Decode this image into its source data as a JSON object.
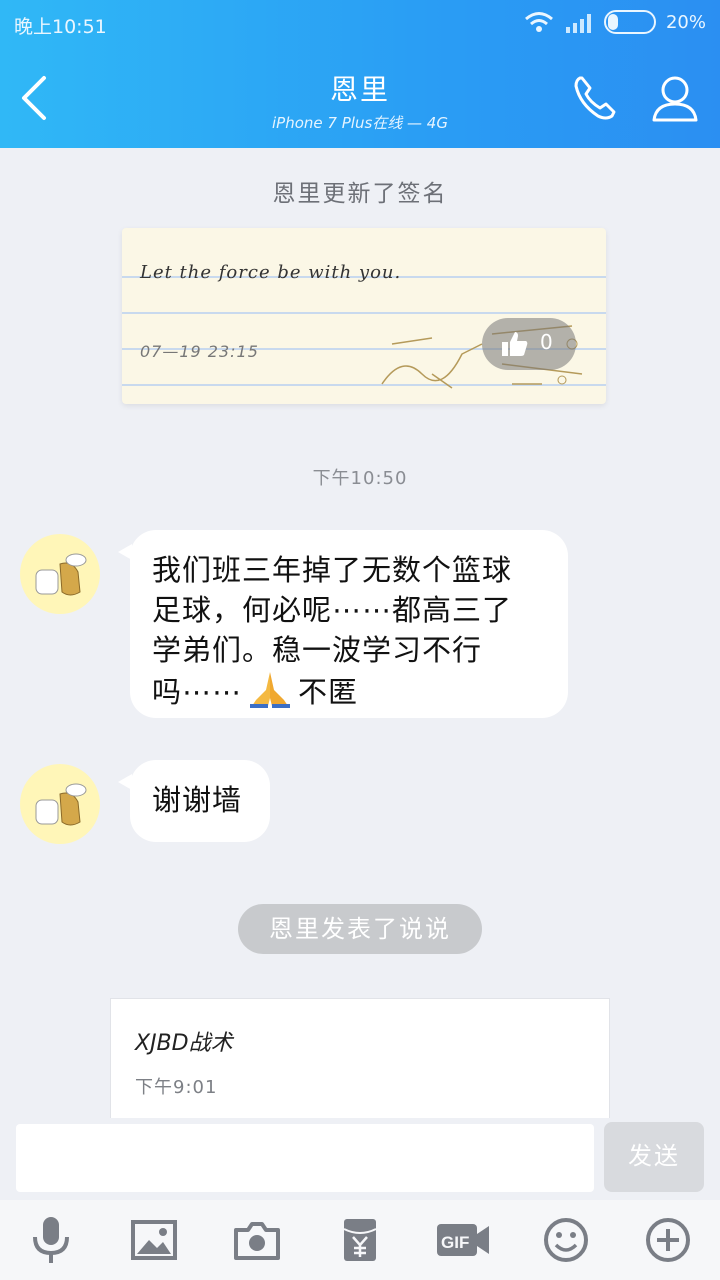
{
  "status_bar": {
    "time": "晚上10:51",
    "battery": "20%",
    "battery_level": 0.2
  },
  "header": {
    "title": "恩里",
    "subtitle": "iPhone 7 Plus在线 — 4G"
  },
  "signature_update": {
    "notice": "恩里更新了签名",
    "text": "Let the force be with you.",
    "date": "07—19 23:15",
    "likes": "0"
  },
  "time_separator": "下午10:50",
  "messages": [
    {
      "line1": "我们班三年掉了无数个篮球",
      "line2": "足球，何必呢⋯⋯都高三了",
      "line3": "学弟们。稳一波学习不行",
      "line4a": "吗⋯⋯",
      "line4b": "不匿"
    },
    {
      "text": "谢谢墙"
    }
  ],
  "post_notice": "恩里发表了说说",
  "post_card": {
    "title": "XJBD战术",
    "time": "下午9:01"
  },
  "input": {
    "value": "",
    "send_label": "发送"
  },
  "colors": {
    "header_start": "#30b8f6",
    "header_end": "#2b8ff2",
    "bubble": "#ffffff",
    "background": "#eef0f5"
  }
}
